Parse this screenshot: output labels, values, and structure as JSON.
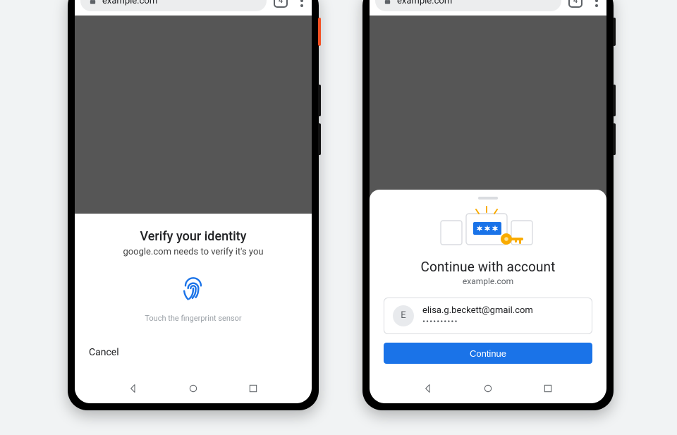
{
  "left_phone": {
    "omnibar": {
      "url": "example.com",
      "tab_count": "4"
    },
    "sheet": {
      "title": "Verify your identity",
      "subtitle": "google.com needs to verify it's you",
      "hint": "Touch the fingerprint sensor",
      "cancel": "Cancel"
    }
  },
  "right_phone": {
    "omnibar": {
      "url": "example.com",
      "tab_count": "4"
    },
    "sheet": {
      "title": "Continue with account",
      "subtitle": "example.com",
      "account": {
        "initial": "E",
        "email": "elisa.g.beckett@gmail.com",
        "password_masked": "••••••••••"
      },
      "cta": "Continue"
    }
  },
  "colors": {
    "primary": "#1a73e8",
    "key_accent": "#f9ab00"
  }
}
